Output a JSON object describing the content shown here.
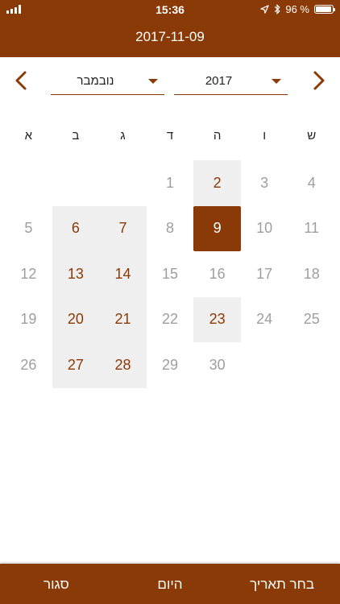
{
  "status": {
    "time": "15:36",
    "battery_text": "96 %",
    "battery_level": 0.96
  },
  "header": {
    "date": "2017-11-09"
  },
  "month_select": {
    "value": "נובמבר"
  },
  "year_select": {
    "value": "2017"
  },
  "weekdays": [
    "ש",
    "ו",
    "ה",
    "ד",
    "ג",
    "ב",
    "א"
  ],
  "calendar": {
    "weeks": [
      [
        {
          "day": "4",
          "state": "normal"
        },
        {
          "day": "3",
          "state": "normal"
        },
        {
          "day": "2",
          "state": "highlight"
        },
        {
          "day": "1",
          "state": "normal"
        },
        {
          "day": "",
          "state": "empty"
        },
        {
          "day": "",
          "state": "empty"
        },
        {
          "day": "",
          "state": "empty"
        }
      ],
      [
        {
          "day": "11",
          "state": "normal"
        },
        {
          "day": "10",
          "state": "normal"
        },
        {
          "day": "9",
          "state": "selected"
        },
        {
          "day": "8",
          "state": "normal"
        },
        {
          "day": "7",
          "state": "highlight"
        },
        {
          "day": "6",
          "state": "highlight"
        },
        {
          "day": "5",
          "state": "normal"
        }
      ],
      [
        {
          "day": "18",
          "state": "normal"
        },
        {
          "day": "17",
          "state": "normal"
        },
        {
          "day": "16",
          "state": "normal"
        },
        {
          "day": "15",
          "state": "normal"
        },
        {
          "day": "14",
          "state": "highlight"
        },
        {
          "day": "13",
          "state": "highlight"
        },
        {
          "day": "12",
          "state": "normal"
        }
      ],
      [
        {
          "day": "25",
          "state": "normal"
        },
        {
          "day": "24",
          "state": "normal"
        },
        {
          "day": "23",
          "state": "highlight"
        },
        {
          "day": "22",
          "state": "normal"
        },
        {
          "day": "21",
          "state": "highlight"
        },
        {
          "day": "20",
          "state": "highlight"
        },
        {
          "day": "19",
          "state": "normal"
        }
      ],
      [
        {
          "day": "",
          "state": "empty"
        },
        {
          "day": "",
          "state": "empty"
        },
        {
          "day": "30",
          "state": "normal"
        },
        {
          "day": "29",
          "state": "normal"
        },
        {
          "day": "28",
          "state": "highlight"
        },
        {
          "day": "27",
          "state": "highlight"
        },
        {
          "day": "26",
          "state": "normal"
        }
      ]
    ]
  },
  "footer": {
    "choose_date": "בחר תאריך",
    "today": "היום",
    "close": "סגור"
  },
  "colors": {
    "accent": "#8a3a06",
    "highlight_bg": "#efefef",
    "muted_text": "#9e9e9e"
  }
}
